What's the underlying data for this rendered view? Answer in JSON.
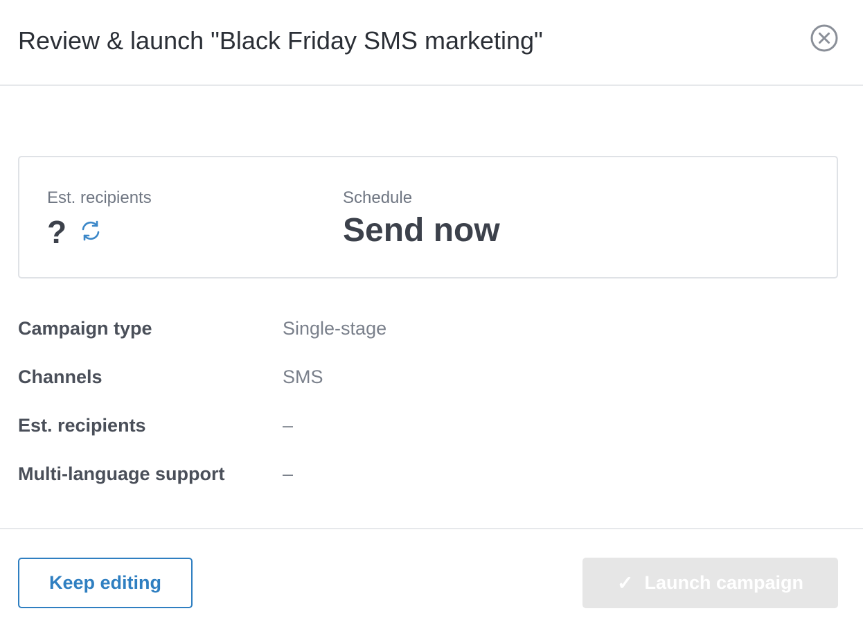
{
  "header": {
    "title": "Review & launch \"Black Friday SMS marketing\"",
    "close_icon": "close-circle-icon"
  },
  "summary": {
    "recipients_label": "Est. recipients",
    "recipients_value": "?",
    "refresh_icon": "refresh-icon",
    "schedule_label": "Schedule",
    "schedule_value": "Send now"
  },
  "details": [
    {
      "key": "Campaign type",
      "value": "Single-stage"
    },
    {
      "key": "Channels",
      "value": "SMS"
    },
    {
      "key": "Est. recipients",
      "value": "–"
    },
    {
      "key": "Multi-language support",
      "value": "–"
    }
  ],
  "footer": {
    "keep_editing_label": "Keep editing",
    "launch_label": "Launch campaign",
    "launch_icon": "checkmark-icon",
    "launch_disabled": true
  },
  "colors": {
    "accent": "#2f7fc1",
    "disabled_button": "#e6e6e6",
    "border": "#dfe2e6"
  }
}
